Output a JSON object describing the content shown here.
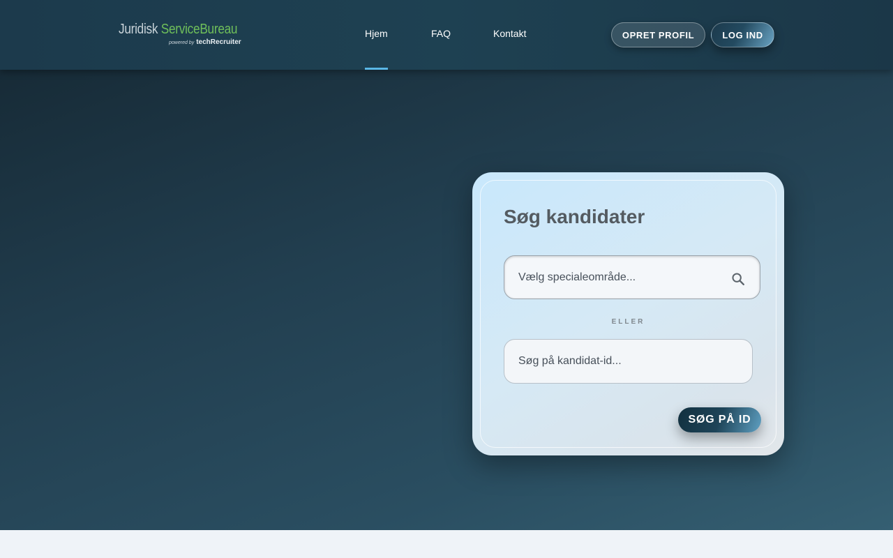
{
  "header": {
    "logo": {
      "part1": "Juridisk",
      "part2": "ServiceBureau",
      "powered_by": "powered by",
      "brand": "techRecruiter"
    },
    "nav": [
      {
        "label": "Hjem",
        "active": true
      },
      {
        "label": "FAQ",
        "active": false
      },
      {
        "label": "Kontakt",
        "active": false
      }
    ],
    "create_profile_label": "OPRET PROFIL",
    "login_label": "LOG IND"
  },
  "search_card": {
    "title": "Søg kandidater",
    "specialty_placeholder": "Vælg specialeområde...",
    "search_icon": "search-icon",
    "or_label": "ELLER",
    "id_placeholder": "Søg på kandidat-id...",
    "search_id_label": "SØG PÅ ID"
  },
  "colors": {
    "header_bg": "#1e4152",
    "accent": "#5ab7e6",
    "logo_green": "#6fbf5a",
    "title_text": "#545b61"
  }
}
